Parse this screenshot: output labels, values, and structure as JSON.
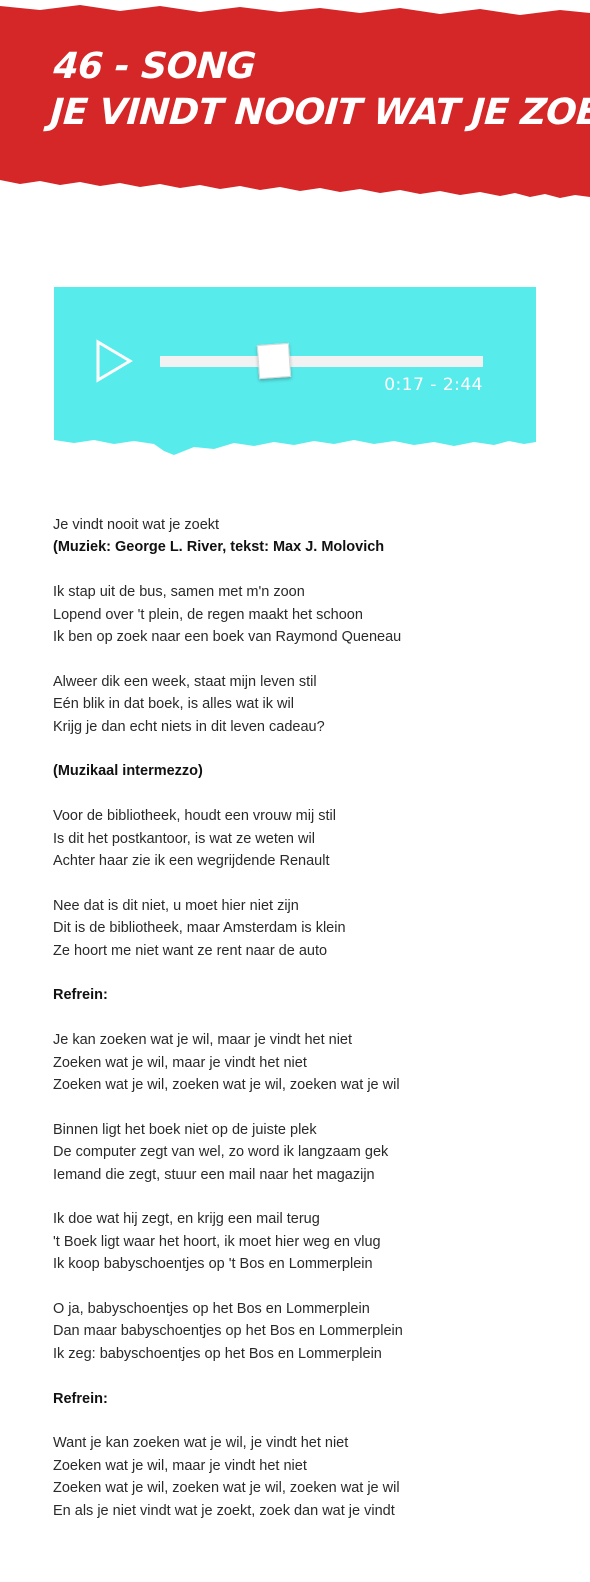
{
  "header": {
    "line1": "46 - SONG",
    "line2": "JE VINDT NOOIT WAT JE ZOEKT",
    "bg_color": "#d52628",
    "text_color": "#ffffff"
  },
  "player": {
    "bg_color": "#58ebeb",
    "play_icon": "play-icon",
    "time": "0:17 - 2:44",
    "progress": 0.25
  },
  "lyrics": [
    {
      "text": "Je vindt nooit wat je zoekt",
      "bold": false
    },
    {
      "text": "(Muziek: George L. River, tekst: Max J. Molovich",
      "bold": true
    },
    {
      "gap": true
    },
    {
      "text": "Ik stap uit de bus, samen met m'n zoon",
      "bold": false
    },
    {
      "text": "Lopend over 't plein, de regen maakt het schoon",
      "bold": false
    },
    {
      "text": "Ik ben op zoek naar een boek van Raymond Queneau",
      "bold": false
    },
    {
      "gap": true
    },
    {
      "text": "Alweer dik een week, staat mijn leven stil",
      "bold": false
    },
    {
      "text": "Eén blik in dat boek, is alles wat ik wil",
      "bold": false
    },
    {
      "text": "Krijg je dan echt niets in dit leven cadeau?",
      "bold": false
    },
    {
      "gap": true
    },
    {
      "text": "(Muzikaal intermezzo)",
      "bold": true
    },
    {
      "gap": true
    },
    {
      "text": "Voor de bibliotheek, houdt een vrouw mij stil",
      "bold": false
    },
    {
      "text": "Is dit het postkantoor, is wat ze weten wil",
      "bold": false
    },
    {
      "text": "Achter haar zie ik een wegrijdende Renault",
      "bold": false
    },
    {
      "gap": true
    },
    {
      "text": "Nee dat is dit niet, u moet hier niet zijn",
      "bold": false
    },
    {
      "text": "Dit is de bibliotheek, maar Amsterdam is klein",
      "bold": false
    },
    {
      "text": "Ze hoort me niet want ze rent naar de auto",
      "bold": false
    },
    {
      "gap": true
    },
    {
      "text": "Refrein:",
      "bold": true
    },
    {
      "gap": true
    },
    {
      "text": "Je kan zoeken wat je wil, maar je vindt het niet",
      "bold": false
    },
    {
      "text": "Zoeken wat je wil, maar je vindt het niet",
      "bold": false
    },
    {
      "text": "Zoeken wat je wil, zoeken wat je wil, zoeken wat je wil",
      "bold": false
    },
    {
      "gap": true
    },
    {
      "text": "Binnen ligt het boek niet op de juiste plek",
      "bold": false
    },
    {
      "text": "De computer zegt van wel, zo word ik langzaam gek",
      "bold": false
    },
    {
      "text": "Iemand die zegt, stuur een mail naar het magazijn",
      "bold": false
    },
    {
      "gap": true
    },
    {
      "text": "Ik doe wat hij zegt, en krijg een mail terug",
      "bold": false
    },
    {
      "text": "'t Boek ligt waar het hoort, ik moet hier weg en vlug",
      "bold": false
    },
    {
      "text": "Ik koop babyschoentjes op 't Bos en Lommerplein",
      "bold": false
    },
    {
      "gap": true
    },
    {
      "text": "O ja, babyschoentjes op het Bos en Lommerplein",
      "bold": false
    },
    {
      "text": "Dan maar babyschoentjes op het Bos en Lommerplein",
      "bold": false
    },
    {
      "text": "Ik zeg: babyschoentjes op het Bos en Lommerplein",
      "bold": false
    },
    {
      "gap": true
    },
    {
      "text": "Refrein:",
      "bold": true
    },
    {
      "gap": true
    },
    {
      "text": "Want je kan zoeken wat je wil, je vindt het niet",
      "bold": false
    },
    {
      "text": "Zoeken wat je wil, maar je vindt het niet",
      "bold": false
    },
    {
      "text": "Zoeken wat je wil, zoeken wat je wil, zoeken wat je wil",
      "bold": false
    },
    {
      "text": "En als je niet vindt wat je zoekt, zoek dan wat je vindt",
      "bold": false
    }
  ]
}
